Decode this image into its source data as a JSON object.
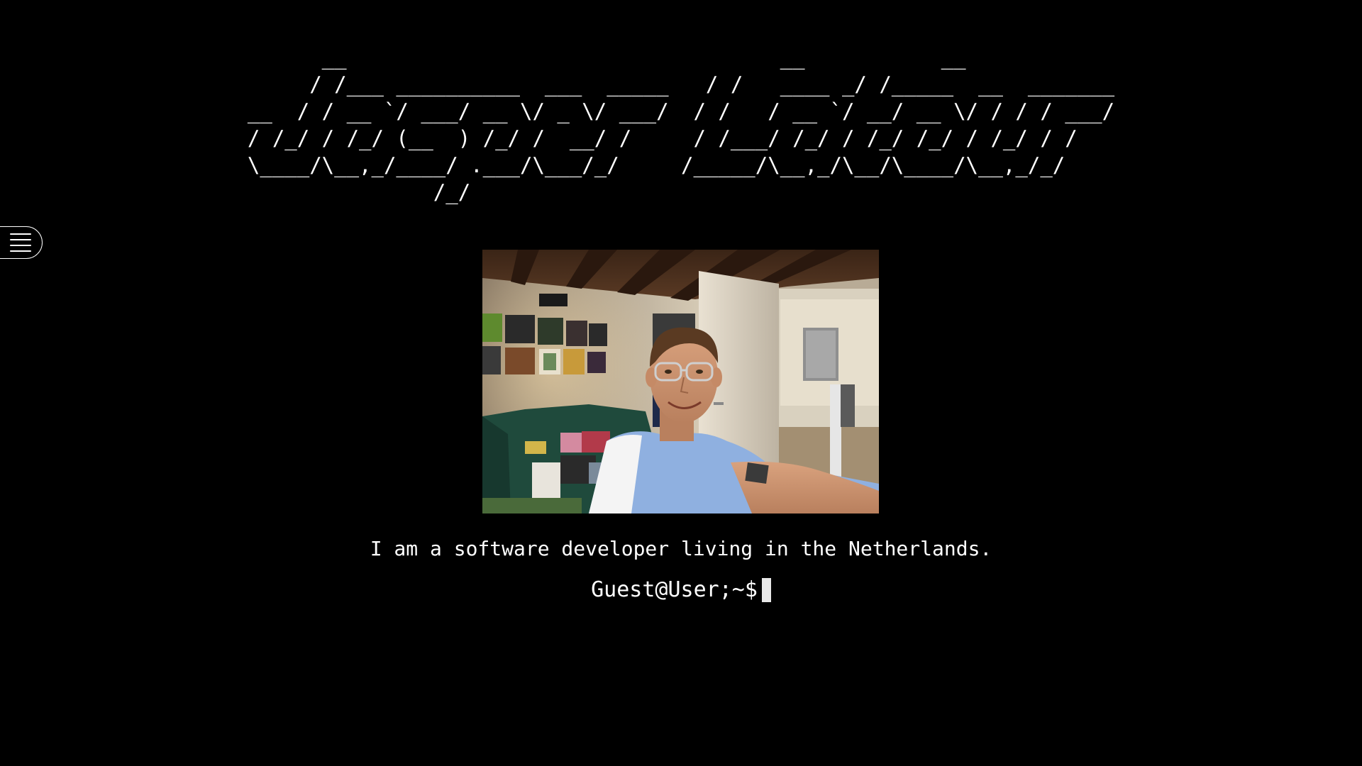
{
  "header": {
    "ascii_banner": "      __                                   __           __\n     / /___ __________  ___  _____   / /   ____ _/ /_____  __  _______\n__  / / __ `/ ___/ __ \\/ _ \\/ ___/  / /   / __ `/ __/ __ \\/ / / / ___/\n/ /_/ / /_/ (__  ) /_/ /  __/ /     / /___/ /_/ / /_/ /_/ / /_/ / /\n\\____/\\__,_/____/ .___/\\___/_/     /_____/\\__,_/\\__/\\____/\\__,_/_/\n               /_/"
  },
  "nav": {
    "menu_icon": "hamburger-menu-icon"
  },
  "profile": {
    "photo_subject": "selfie-photo"
  },
  "intro": {
    "tagline": "I am a software developer living in the Netherlands."
  },
  "terminal": {
    "prompt": "Guest@User;~$"
  }
}
